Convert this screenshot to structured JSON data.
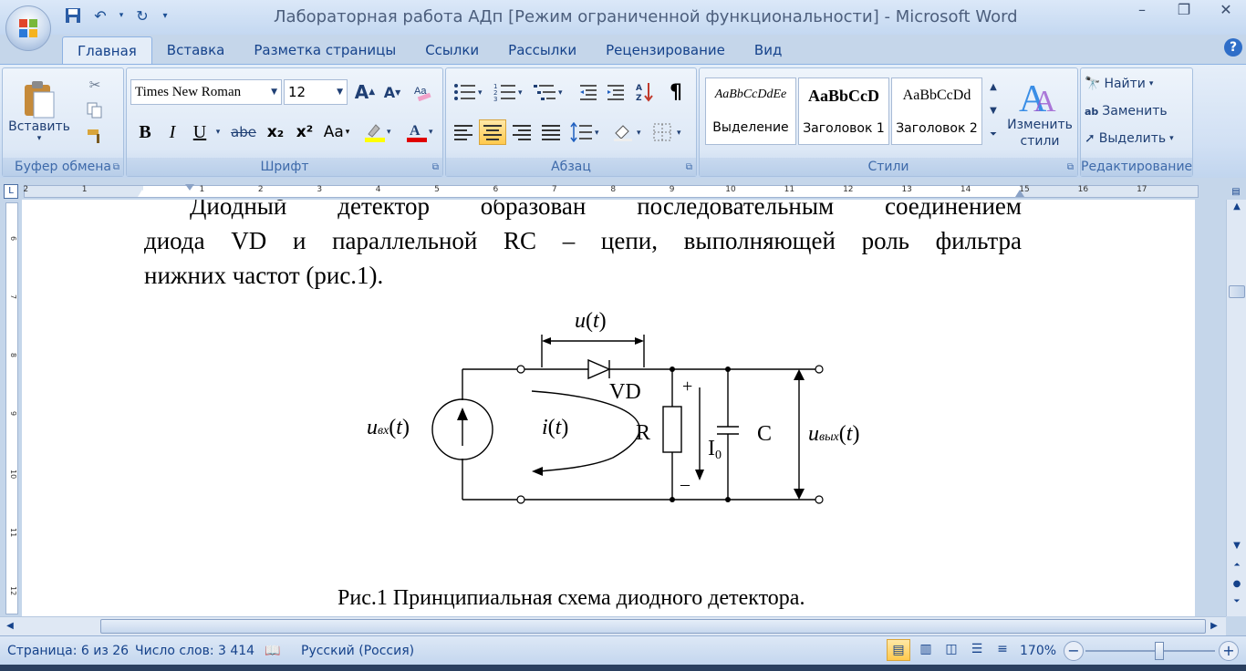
{
  "window": {
    "title": "Лабораторная работа АДп [Режим ограниченной функциональности] - Microsoft Word",
    "controls": [
      "–",
      "❐",
      "✕"
    ]
  },
  "quick_access": {
    "items": [
      "save-icon",
      "undo-icon",
      "redo-icon",
      "customize-icon"
    ]
  },
  "tabs": [
    {
      "label": "Главная",
      "active": true
    },
    {
      "label": "Вставка"
    },
    {
      "label": "Разметка страницы"
    },
    {
      "label": "Ссылки"
    },
    {
      "label": "Рассылки"
    },
    {
      "label": "Рецензирование"
    },
    {
      "label": "Вид"
    }
  ],
  "ribbon": {
    "clipboard": {
      "label": "Буфер обмена",
      "paste": "Вставить"
    },
    "font": {
      "label": "Шрифт",
      "font_name": "Times New Roman",
      "font_size": "12",
      "bold": "B",
      "italic": "I",
      "underline": "U",
      "strike": "abe",
      "subscript": "x₂",
      "superscript": "x²",
      "case": "Aa",
      "grow": "A",
      "shrink": "A",
      "highlight_color": "#ffff00",
      "font_color": "#e00000"
    },
    "paragraph": {
      "label": "Абзац",
      "pilcrow": "¶"
    },
    "styles": {
      "label": "Стили",
      "items": [
        {
          "preview": "AaBbCcDdEe",
          "name": "Выделение"
        },
        {
          "preview": "AaBbCcD",
          "name": "Заголовок 1"
        },
        {
          "preview": "AaBbCcDd",
          "name": "Заголовок 2"
        }
      ],
      "change_styles": "Изменить стили"
    },
    "editing": {
      "label": "Редактирование",
      "find": "Найти",
      "replace": "Заменить",
      "select": "Выделить"
    }
  },
  "ruler": {
    "numbers": [
      "2",
      "1",
      "1",
      "2",
      "3",
      "4",
      "5",
      "6",
      "7",
      "8",
      "9",
      "10",
      "11",
      "12",
      "13",
      "14",
      "15",
      "16",
      "17"
    ]
  },
  "vruler": {
    "numbers": [
      "6",
      "7",
      "8",
      "9",
      "10",
      "11",
      "12"
    ]
  },
  "document": {
    "paragraph_lines": [
      "Диодный детектор образован последовательным соединением",
      "диода VD и параллельной RC – цепи, выполняющей роль фильтра",
      "нижних частот (рис.1)."
    ],
    "figure_labels": {
      "u_top": "u",
      "t": "t",
      "vd": "VD",
      "r": "R",
      "c": "C",
      "i0": "I",
      "i0_sub": "0",
      "i": "i",
      "u_in_main": "u",
      "u_in_sub": "вх",
      "u_out_main": "u",
      "u_out_sub": "вых",
      "plus": "+",
      "minus": "–"
    },
    "caption": "Рис.1 Принципиальная схема диодного детектора."
  },
  "statusbar": {
    "page": "Страница: 6 из 26",
    "words": "Число слов: 3 414",
    "language": "Русский (Россия)",
    "zoom": "170%"
  }
}
